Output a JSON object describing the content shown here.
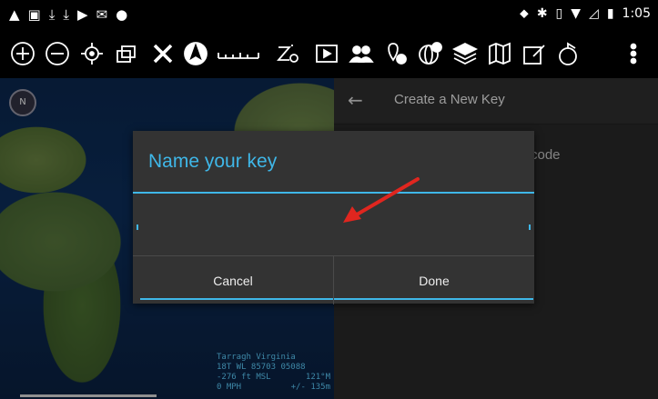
{
  "status_bar": {
    "time": "1:05",
    "left_icons": [
      "warning-icon",
      "image-icon",
      "download-icon",
      "download-icon",
      "youtube-icon",
      "gmail-icon",
      "android-icon"
    ],
    "right_icons": [
      "location-icon",
      "bluetooth-icon",
      "vibrate-icon",
      "wifi-icon",
      "signal-icon",
      "battery-icon"
    ]
  },
  "toolbar": {
    "tools": [
      "zoom-in",
      "zoom-out",
      "gps-locate",
      "layers-stack",
      "cross-out",
      "compass-rose",
      "ruler",
      "zoom-level",
      "play",
      "contacts",
      "add-marker",
      "globe-add",
      "layers",
      "map",
      "edit",
      "share",
      "more"
    ]
  },
  "map": {
    "compass_label": "N",
    "readout": {
      "line1": "Tarragh Virginia",
      "line2a": "18T  WL  85703  05088",
      "line3a": "-276 ft MSL",
      "line3b": "121°M",
      "line4a": "0 MPH",
      "line4b": "+/- 135m"
    }
  },
  "key_panel": {
    "title": "Create a New Key",
    "item_partial": "code"
  },
  "dialog": {
    "title": "Name your key",
    "input_value": "",
    "cancel_label": "Cancel",
    "done_label": "Done"
  },
  "annotation": {
    "arrow_color": "#e0261f"
  }
}
